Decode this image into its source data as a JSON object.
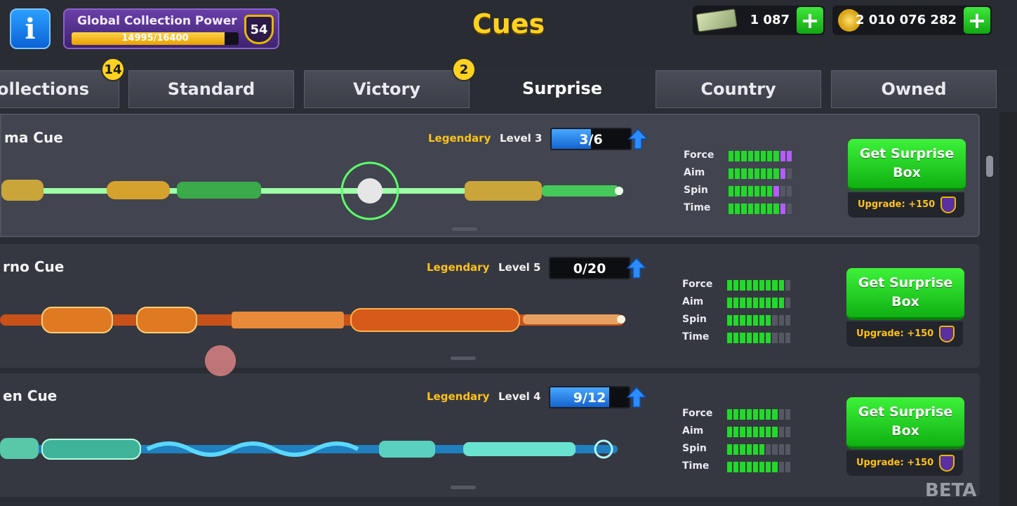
{
  "header": {
    "info_icon_label": "i",
    "title": "Cues",
    "collection_power": {
      "label": "Global Collection Power",
      "progress_text": "14995/16400",
      "progress": 0.914,
      "level": "54"
    },
    "cash": {
      "icon": "cash-icon",
      "value": "1 087",
      "add_label": "+"
    },
    "coins": {
      "icon": "coin-icon",
      "value": "2 010 076 282",
      "add_label": "+"
    }
  },
  "tabs": [
    {
      "label": "ollections",
      "badge": "14",
      "active": false
    },
    {
      "label": "Standard",
      "badge": "",
      "active": false
    },
    {
      "label": "Victory",
      "badge": "2",
      "active": false
    },
    {
      "label": "Surprise",
      "badge": "",
      "active": true
    },
    {
      "label": "Country",
      "badge": "",
      "active": false
    },
    {
      "label": "Owned",
      "badge": "",
      "active": false
    }
  ],
  "cues": [
    {
      "name": "ma Cue",
      "rarity": "Legendary",
      "level": "Level 3",
      "progress_text": "3/6",
      "progress": 0.5,
      "stats": [
        {
          "label": "Force",
          "green": 8,
          "purple": 2
        },
        {
          "label": "Aim",
          "green": 8,
          "purple": 1
        },
        {
          "label": "Spin",
          "green": 7,
          "purple": 1
        },
        {
          "label": "Time",
          "green": 8,
          "purple": 1
        }
      ],
      "button_label": "Get Surprise Box",
      "upgrade_text": "Upgrade: +150",
      "accent": "#7dff8a"
    },
    {
      "name": "rno Cue",
      "rarity": "Legendary",
      "level": "Level 5",
      "progress_text": "0/20",
      "progress": 0.0,
      "stats": [
        {
          "label": "Force",
          "green": 9,
          "purple": 0
        },
        {
          "label": "Aim",
          "green": 9,
          "purple": 0
        },
        {
          "label": "Spin",
          "green": 7,
          "purple": 0
        },
        {
          "label": "Time",
          "green": 7,
          "purple": 0
        }
      ],
      "button_label": "Get Surprise Box",
      "upgrade_text": "Upgrade: +150",
      "accent": "#ff7a2a"
    },
    {
      "name": "en Cue",
      "rarity": "Legendary",
      "level": "Level 4",
      "progress_text": "9/12",
      "progress": 0.75,
      "stats": [
        {
          "label": "Force",
          "green": 8,
          "purple": 0
        },
        {
          "label": "Aim",
          "green": 8,
          "purple": 0
        },
        {
          "label": "Spin",
          "green": 6,
          "purple": 0
        },
        {
          "label": "Time",
          "green": 8,
          "purple": 0
        }
      ],
      "button_label": "Get Surprise Box",
      "upgrade_text": "Upgrade: +150",
      "accent": "#3fd0ff"
    }
  ],
  "footer": {
    "beta_label": "BETA"
  }
}
